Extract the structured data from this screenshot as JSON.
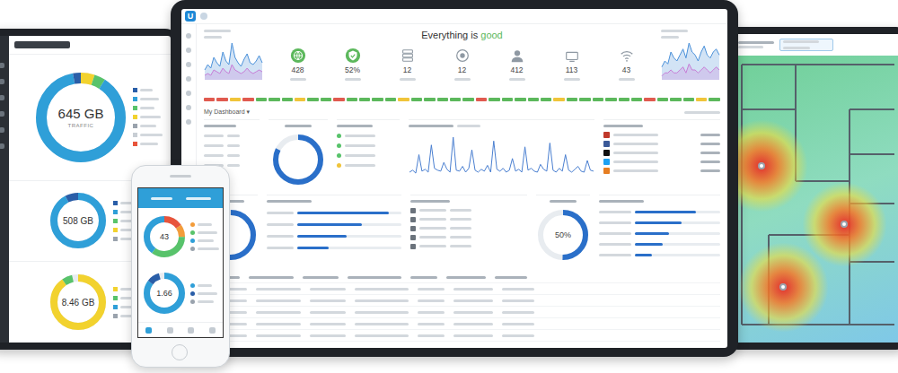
{
  "left_tablet": {
    "traffic_ring": {
      "value": "645 GB",
      "label": "TRAFFIC",
      "segments": [
        {
          "level": 0.05,
          "color": "#f2d22e"
        },
        {
          "level": 0.04,
          "color": "#58c36b"
        },
        {
          "level": 0.88,
          "color": "#2f9fd8"
        },
        {
          "level": 0.03,
          "color": "#2a5ea8"
        }
      ]
    },
    "legend": [
      {
        "color": "#2a5ea8"
      },
      {
        "color": "#2f9fd8"
      },
      {
        "color": "#58c36b"
      },
      {
        "color": "#f2d22e"
      },
      {
        "color": "#9aa3ad"
      },
      {
        "color": "#c8ced4"
      },
      {
        "color": "#e8543b"
      }
    ],
    "rings": [
      {
        "value": "508 GB",
        "segments": [
          {
            "level": 0.92,
            "color": "#2f9fd8"
          },
          {
            "level": 0.08,
            "color": "#2a5ea8"
          }
        ],
        "legend": [
          {
            "color": "#2a5ea8"
          },
          {
            "color": "#2f9fd8"
          },
          {
            "color": "#58c36b"
          },
          {
            "color": "#f2d22e"
          },
          {
            "color": "#9aa3ad"
          }
        ]
      },
      {
        "value": "8.46 GB",
        "segments": [
          {
            "level": 0.9,
            "color": "#f2d22e"
          },
          {
            "level": 0.06,
            "color": "#58c36b"
          }
        ],
        "legend": [
          {
            "color": "#f2d22e"
          },
          {
            "color": "#58c36b"
          },
          {
            "color": "#2f9fd8"
          },
          {
            "color": "#9aa3ad"
          }
        ]
      }
    ]
  },
  "main": {
    "logo": "U",
    "title": {
      "text": "Everything is ",
      "status": "good",
      "color": "#5cb85c"
    },
    "mini_left": {
      "series": [
        {
          "color": "#4a90d9",
          "values": [
            5,
            8,
            6,
            12,
            9,
            7,
            15,
            10,
            8,
            20,
            12,
            9,
            7,
            11,
            14,
            9,
            8,
            10,
            13,
            9
          ]
        },
        {
          "color": "#c77dd6",
          "values": [
            2,
            3,
            2,
            5,
            4,
            3,
            6,
            4,
            3,
            8,
            5,
            4,
            3,
            4,
            6,
            4,
            3,
            4,
            5,
            4
          ]
        }
      ]
    },
    "mini_right": {
      "series": [
        {
          "color": "#4a90d9",
          "values": [
            4,
            6,
            5,
            9,
            7,
            6,
            8,
            10,
            7,
            12,
            9,
            8,
            6,
            9,
            11,
            8,
            7,
            9,
            10,
            8
          ]
        },
        {
          "color": "#c77dd6",
          "values": [
            1,
            2,
            2,
            3,
            2,
            2,
            3,
            4,
            2,
            5,
            3,
            3,
            2,
            3,
            4,
            3,
            2,
            3,
            4,
            3
          ]
        }
      ]
    },
    "stats": [
      {
        "value": "428",
        "color": "#5cb85c"
      },
      {
        "value": "52%",
        "color": "#5cb85c"
      },
      {
        "value": "12",
        "color": "#8f99a3"
      },
      {
        "value": "12",
        "color": "#8f99a3"
      },
      {
        "value": "412",
        "color": "#8f99a3"
      },
      {
        "value": "113",
        "color": "#8f99a3"
      },
      {
        "value": "43",
        "color": "#8f99a3"
      }
    ],
    "health": [
      "#e05a4f",
      "#e05a4f",
      "#f0c43a",
      "#e05a4f",
      "#5cb85c",
      "#5cb85c",
      "#5cb85c",
      "#f0c43a",
      "#5cb85c",
      "#5cb85c",
      "#e05a4f",
      "#5cb85c",
      "#5cb85c",
      "#5cb85c",
      "#5cb85c",
      "#f0c43a",
      "#5cb85c",
      "#5cb85c",
      "#5cb85c",
      "#5cb85c",
      "#5cb85c",
      "#e05a4f",
      "#5cb85c",
      "#5cb85c",
      "#5cb85c",
      "#5cb85c",
      "#5cb85c",
      "#f0c43a",
      "#5cb85c",
      "#5cb85c",
      "#5cb85c",
      "#5cb85c",
      "#5cb85c",
      "#5cb85c",
      "#e05a4f",
      "#5cb85c",
      "#5cb85c",
      "#5cb85c",
      "#f0c43a",
      "#5cb85c"
    ],
    "dashboard": {
      "label": "My Dashboard",
      "caret": "▾"
    },
    "donut_a": {
      "segments": [
        {
          "level": 0.82,
          "color": "#2a6fc9"
        }
      ]
    },
    "client_list": [
      {
        "color": "#58c36b"
      },
      {
        "color": "#58c36b"
      },
      {
        "color": "#58c36b"
      },
      {
        "color": "#f0c43a"
      }
    ],
    "traffic": {
      "series": [
        {
          "color": "#4a7fd0",
          "values": [
            12,
            14,
            11,
            30,
            13,
            15,
            12,
            40,
            16,
            14,
            13,
            22,
            15,
            12,
            48,
            14,
            13,
            18,
            12,
            16,
            35,
            14,
            12,
            15,
            13,
            19,
            12,
            44,
            15,
            13,
            16,
            12,
            14,
            26,
            13,
            15,
            12,
            38,
            14,
            16,
            13,
            12,
            20,
            15,
            13,
            42,
            14,
            12,
            16,
            13,
            30,
            14,
            12,
            15,
            18,
            13,
            12,
            24,
            14,
            13
          ]
        }
      ]
    },
    "apps": [
      {
        "color": "#c0392b"
      },
      {
        "color": "#3b5998"
      },
      {
        "color": "#111111"
      },
      {
        "color": "#1da1f2"
      },
      {
        "color": "#e67e22"
      }
    ],
    "donut_b": {
      "segments": [
        {
          "level": 0.6,
          "color": "#2a6fc9"
        }
      ]
    },
    "bars_a": [
      {
        "level": 0.88
      },
      {
        "level": 0.62
      },
      {
        "level": 0.47
      },
      {
        "level": 0.3
      }
    ],
    "donut_c": {
      "value": "50%",
      "segments": [
        {
          "level": 0.5,
          "color": "#2a6fc9"
        }
      ]
    },
    "bars_b": [
      {
        "level": 0.72
      },
      {
        "level": 0.55
      },
      {
        "level": 0.4
      },
      {
        "level": 0.33
      },
      {
        "level": 0.2
      }
    ]
  },
  "phone": {
    "rings": [
      {
        "value": "43",
        "segments": [
          {
            "level": 0.15,
            "color": "#e8543b"
          },
          {
            "level": 0.1,
            "color": "#f39c3a"
          },
          {
            "level": 0.35,
            "color": "#58c36b"
          },
          {
            "level": 0.4,
            "color": "#2f9fd8"
          }
        ],
        "legend": [
          {
            "color": "#f39c3a"
          },
          {
            "color": "#58c36b"
          },
          {
            "color": "#2f9fd8"
          },
          {
            "color": "#9aa3ad"
          }
        ]
      },
      {
        "value": "1.66",
        "segments": [
          {
            "level": 0.85,
            "color": "#2f9fd8"
          },
          {
            "level": 0.1,
            "color": "#2a5ea8"
          }
        ],
        "legend": [
          {
            "color": "#2f9fd8"
          },
          {
            "color": "#2a5ea8"
          },
          {
            "color": "#9aa3ad"
          }
        ]
      }
    ],
    "nav": [
      {
        "selected": true
      },
      {
        "selected": false
      },
      {
        "selected": false
      },
      {
        "selected": false
      }
    ]
  },
  "heatmap": {
    "access_points": [
      {
        "level": 0.9
      },
      {
        "level": 0.75
      },
      {
        "level": 0.85
      }
    ]
  }
}
